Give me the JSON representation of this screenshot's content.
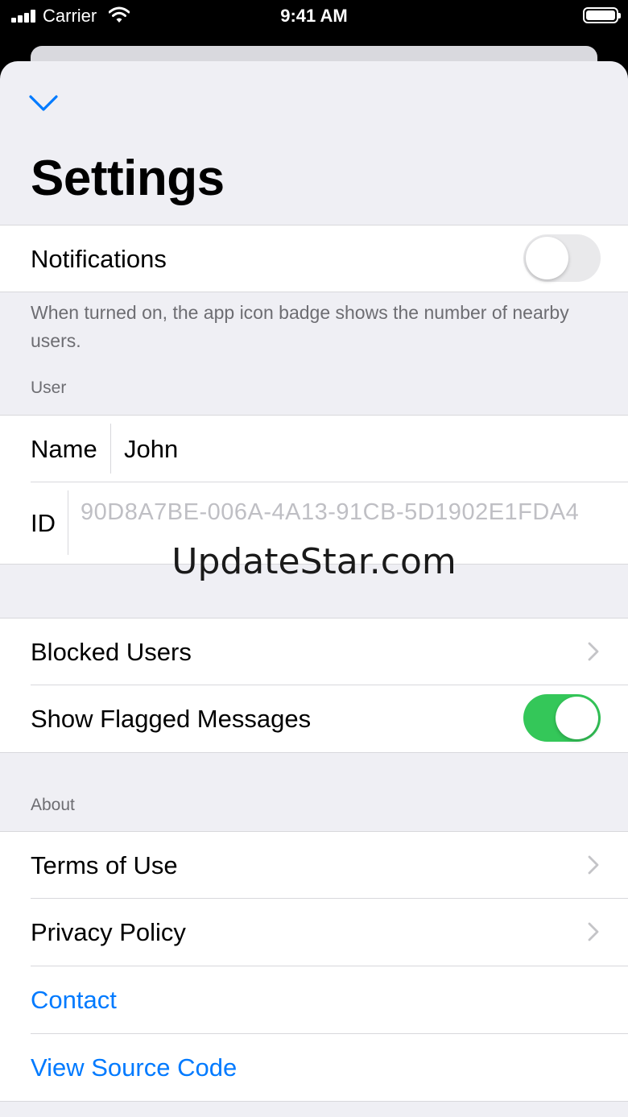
{
  "status_bar": {
    "carrier": "Carrier",
    "time": "9:41 AM",
    "icons": [
      "signal-icon",
      "wifi-icon",
      "battery-icon"
    ]
  },
  "header": {
    "dismiss_icon": "chevron-down-icon",
    "title": "Settings"
  },
  "notifications": {
    "label": "Notifications",
    "toggle_on": false,
    "footer": "When turned on, the app icon badge shows the number of nearby users."
  },
  "user": {
    "section_header": "User",
    "name_label": "Name",
    "name_value": "John",
    "id_label": "ID",
    "id_value": "90D8A7BE-006A-4A13-91CB-5D1902E1FDA4"
  },
  "watermark": "UpdateStar.com",
  "options": {
    "blocked_users_label": "Blocked Users",
    "show_flagged_label": "Show Flagged Messages",
    "show_flagged_on": true
  },
  "about": {
    "section_header": "About",
    "terms_label": "Terms of Use",
    "privacy_label": "Privacy Policy",
    "contact_label": "Contact",
    "source_label": "View Source Code"
  },
  "colors": {
    "accent": "#007aff",
    "toggle_on": "#34c759",
    "grouped_background": "#efeff4"
  }
}
